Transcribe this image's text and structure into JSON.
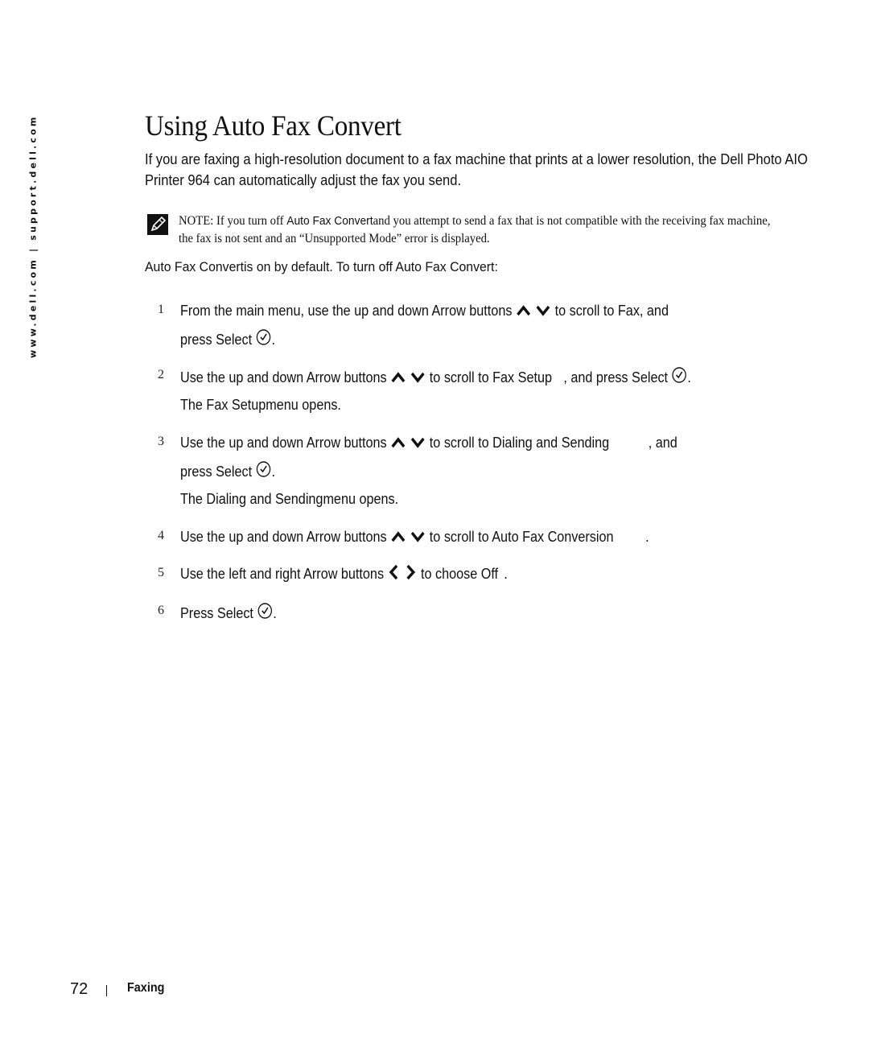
{
  "sidebar": {
    "url_text": "www.dell.com | support.dell.com"
  },
  "page": {
    "title": "Using Auto Fax Convert",
    "intro": "If you are faxing a high-resolution document to a fax machine that prints at a lower resolution, the Dell Photo AIO  Printer 964 can automatically adjust the fax you send.",
    "note": {
      "icon": "pencil-note-icon",
      "label": "NOTE:",
      "text_before": " If you turn off ",
      "term": "Auto Fax Convert",
      "text_after": "and you attempt to send a fax that is not compatible with the receiving fax machine, the fax is not sent and an “Unsupported Mode” error is displayed."
    },
    "default_line": {
      "term1": "Auto Fax Convert",
      "text": "is on by default. To turn off ",
      "term2": "Auto Fax Convert",
      "end": ":"
    },
    "steps": [
      {
        "number": "1",
        "line1": {
          "before": "From the main menu, use the up and down Arrow buttons",
          "icons": [
            "up-arrow-icon",
            "down-arrow-icon"
          ],
          "after_icons": "to scroll to ",
          "term": "Fax",
          "after": ", and"
        },
        "line2": {
          "before": "press Select",
          "icon": "select-check-icon",
          "after": "."
        }
      },
      {
        "number": "2",
        "line1": {
          "before": "Use the up and down Arrow buttons",
          "icons": [
            "up-arrow-icon",
            "down-arrow-icon"
          ],
          "after_icons": "to scroll to ",
          "term": "Fax Setup",
          "after": ", and press Select",
          "icon": "select-check-icon",
          "end": "."
        },
        "result": {
          "before": "The ",
          "term": "Fax Setup",
          "after": "menu opens."
        }
      },
      {
        "number": "3",
        "line1": {
          "before": "Use the up and down Arrow buttons",
          "icons": [
            "up-arrow-icon",
            "down-arrow-icon"
          ],
          "after_icons": "to scroll to ",
          "term": "Dialing and Sending",
          "after": ", and"
        },
        "line2": {
          "before": "press Select",
          "icon": "select-check-icon",
          "after": "."
        },
        "result": {
          "before": "The ",
          "term": "Dialing and Sending",
          "after": "menu opens."
        }
      },
      {
        "number": "4",
        "line1": {
          "before": "Use the up and down Arrow buttons",
          "icons": [
            "up-arrow-icon",
            "down-arrow-icon"
          ],
          "after_icons": "to scroll to ",
          "term": "Auto Fax Conversion",
          "after": "."
        }
      },
      {
        "number": "5",
        "line1": {
          "before": "Use the left and right Arrow buttons",
          "icons": [
            "left-arrow-icon",
            "right-arrow-icon"
          ],
          "after_icons": "to choose ",
          "term": "Off",
          "after": "."
        }
      },
      {
        "number": "6",
        "line1": {
          "before": "Press Select",
          "icon": "select-check-icon",
          "after": "."
        }
      }
    ]
  },
  "footer": {
    "page_number": "72",
    "section": "Faxing"
  }
}
